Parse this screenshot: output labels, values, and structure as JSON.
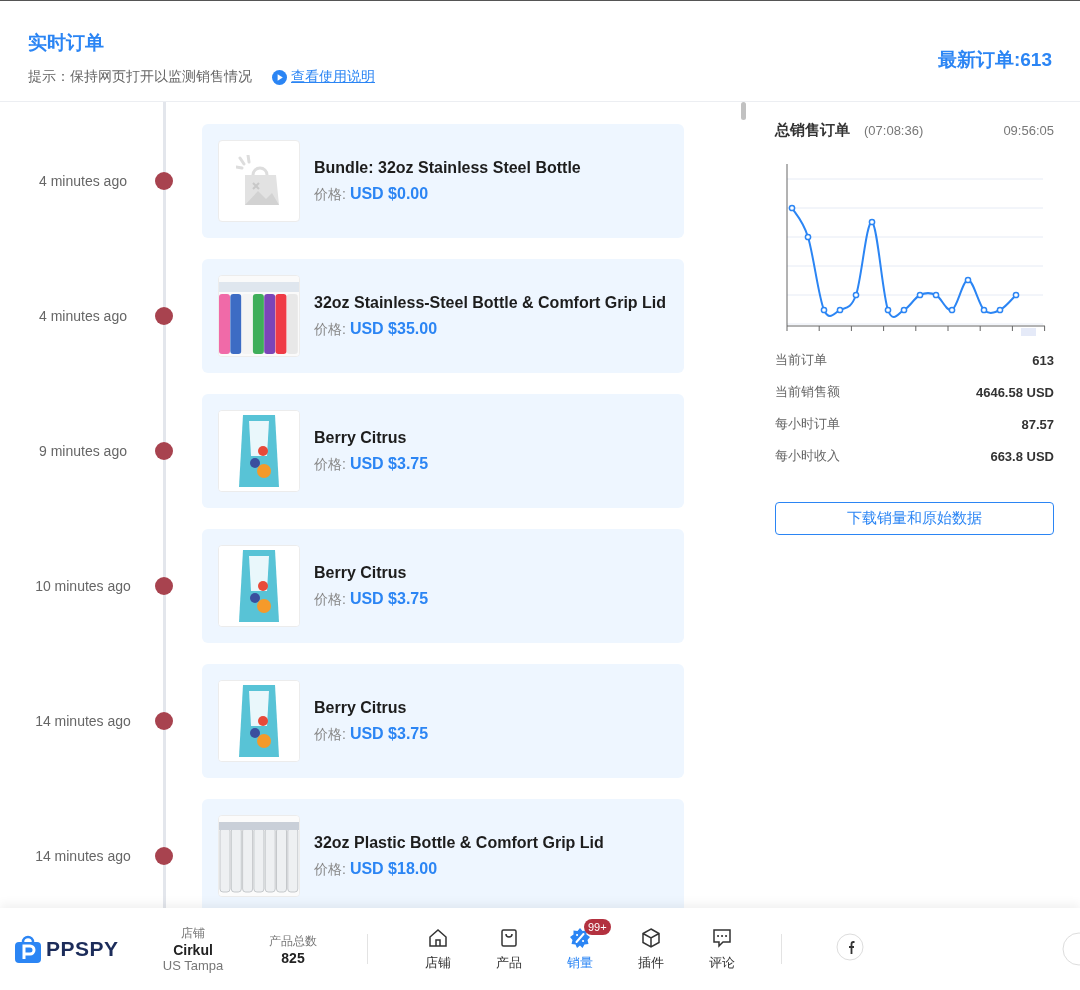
{
  "header": {
    "title": "实时订单",
    "hint": "提示：保持网页打开以监测销售情况",
    "help_link": "查看使用说明",
    "latest": "最新订单:613"
  },
  "orders": [
    {
      "time": "4 minutes ago",
      "name": "Bundle: 32oz Stainless Steel Bottle",
      "price_label": "价格:",
      "price": "USD $0.00",
      "kind": "placeholder"
    },
    {
      "time": "4 minutes ago",
      "name": "32oz Stainless-Steel Bottle & Comfort Grip Lid",
      "price_label": "价格:",
      "price": "USD $35.00",
      "kind": "picture"
    },
    {
      "time": "9 minutes ago",
      "name": "Berry Citrus",
      "price_label": "价格:",
      "price": "USD $3.75",
      "kind": "picture"
    },
    {
      "time": "10 minutes ago",
      "name": "Berry Citrus",
      "price_label": "价格:",
      "price": "USD $3.75",
      "kind": "picture"
    },
    {
      "time": "14 minutes ago",
      "name": "Berry Citrus",
      "price_label": "价格:",
      "price": "USD $3.75",
      "kind": "picture"
    },
    {
      "time": "14 minutes ago",
      "name": "32oz Plastic Bottle & Comfort Grip Lid",
      "price_label": "价格:",
      "price": "USD $18.00",
      "kind": "picture"
    }
  ],
  "summary": {
    "title": "总销售订单",
    "duration": "(07:08:36)",
    "time": "09:56:05",
    "stats": [
      {
        "label": "当前订单",
        "value": "613"
      },
      {
        "label": "当前销售额",
        "value": "4646.58 USD"
      },
      {
        "label": "每小时订单",
        "value": "87.57"
      },
      {
        "label": "每小时收入",
        "value": "663.8 USD"
      }
    ],
    "download_button": "下载销量和原始数据"
  },
  "bottom_bar": {
    "logo": "PPSPY",
    "store_label": "店铺",
    "store_name": "Cirkul",
    "store_location": "US Tampa",
    "count_label": "产品总数",
    "count": "825",
    "nav": [
      {
        "label": "店铺",
        "kind": "home",
        "selected": false
      },
      {
        "label": "产品",
        "kind": "bag",
        "selected": false
      },
      {
        "label": "销量",
        "kind": "percent",
        "selected": true,
        "badge": "99+"
      },
      {
        "label": "插件",
        "kind": "cube",
        "selected": false
      },
      {
        "label": "评论",
        "kind": "chat",
        "selected": false
      }
    ]
  }
}
